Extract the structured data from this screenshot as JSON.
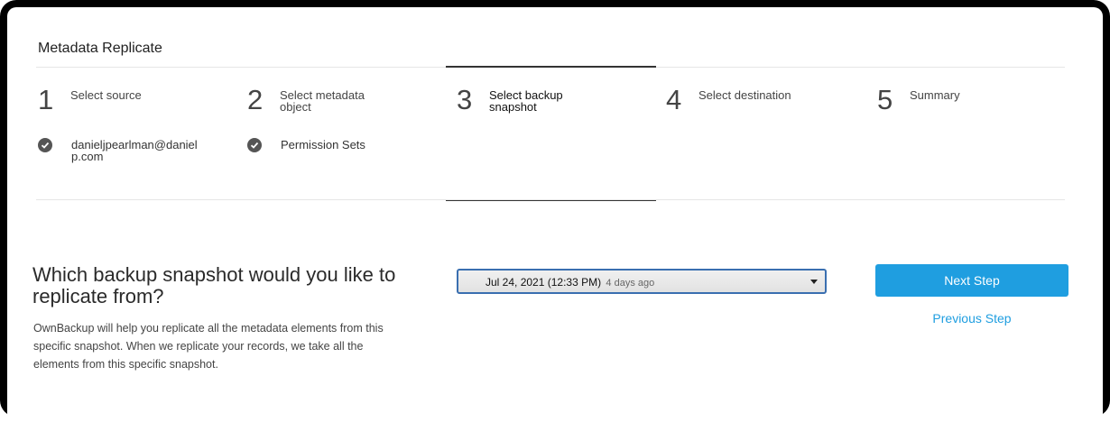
{
  "header": {
    "title": "Metadata Replicate"
  },
  "steps": [
    {
      "number": "1",
      "label": "Select source",
      "done_value": "danieljpearlman@danielp.com"
    },
    {
      "number": "2",
      "label": "Select metadata object",
      "done_value": "Permission Sets"
    },
    {
      "number": "3",
      "label": "Select backup snapshot"
    },
    {
      "number": "4",
      "label": "Select destination"
    },
    {
      "number": "5",
      "label": "Summary"
    }
  ],
  "main": {
    "question": "Which backup snapshot would you like to replicate from?",
    "description": "OwnBackup will help you replicate all the metadata elements from this specific snapshot. When we replicate your records, we take all the elements from this specific snapshot.",
    "snapshot_select": {
      "value": "Jul 24, 2021 (12:33 PM)",
      "relative": "4 days ago"
    },
    "next_label": "Next Step",
    "previous_label": "Previous Step"
  },
  "active_step": 3,
  "colors": {
    "accent": "#1f9ee0",
    "active_border": "#3a6fb0",
    "check": "#555555"
  }
}
